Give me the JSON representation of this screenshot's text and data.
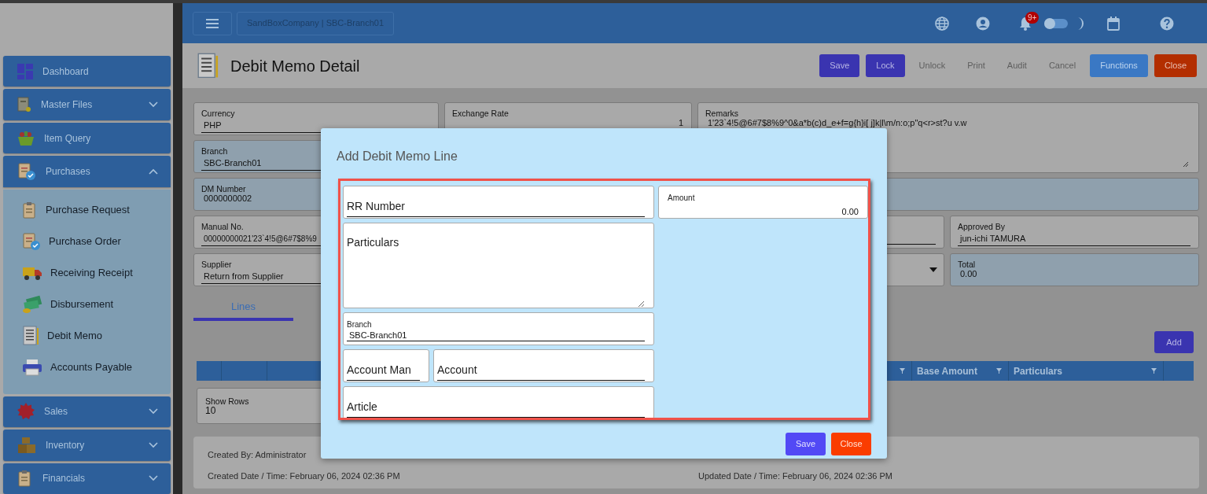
{
  "sidebar": {
    "items": [
      {
        "label": "Dashboard",
        "kind": "link"
      },
      {
        "label": "Master Files",
        "kind": "group",
        "expanded": false
      },
      {
        "label": "Item Query",
        "kind": "link"
      },
      {
        "label": "Purchases",
        "kind": "group",
        "expanded": true,
        "children": [
          {
            "label": "Purchase Request"
          },
          {
            "label": "Purchase Order"
          },
          {
            "label": "Receiving Receipt"
          },
          {
            "label": "Disbursement"
          },
          {
            "label": "Debit Memo"
          },
          {
            "label": "Accounts Payable"
          }
        ]
      },
      {
        "label": "Sales",
        "kind": "group",
        "expanded": false
      },
      {
        "label": "Inventory",
        "kind": "group",
        "expanded": false
      },
      {
        "label": "Financials",
        "kind": "group",
        "expanded": false
      }
    ]
  },
  "topbar": {
    "company": "SandBoxCompany | SBC-Branch01",
    "notification_badge": "9+",
    "dark_mode": false
  },
  "page": {
    "title": "Debit Memo Detail",
    "actions": [
      {
        "label": "Save",
        "kind": "primary",
        "disabled": false
      },
      {
        "label": "Lock",
        "kind": "primary",
        "disabled": false
      },
      {
        "label": "Unlock",
        "disabled": true
      },
      {
        "label": "Print",
        "disabled": true
      },
      {
        "label": "Audit",
        "disabled": true
      },
      {
        "label": "Cancel",
        "disabled": true
      },
      {
        "label": "Functions",
        "kind": "info",
        "disabled": false
      },
      {
        "label": "Close",
        "kind": "danger",
        "disabled": false
      }
    ]
  },
  "form": {
    "fields": [
      {
        "label": "Currency",
        "value": "PHP",
        "kind": "text",
        "disabled": false
      },
      {
        "label": "Exchange Rate",
        "value": "1",
        "kind": "number",
        "disabled": false
      },
      {
        "label": "Remarks",
        "value": "1'23`4!5@6#7$8%9^0&a*b(c)d_e+f=g{h}i[ j]k|l\\m/n:o;p\"q<r>st?u v.w",
        "kind": "textarea",
        "disabled": false
      },
      {
        "label": "Branch",
        "value": "SBC-Branch01",
        "kind": "text",
        "disabled": true
      },
      {
        "label": "DM Number",
        "value": "0000000002",
        "kind": "plain",
        "disabled": true
      },
      {
        "kind": "plain",
        "disabled": true
      },
      {
        "label": "Manual No.",
        "value": "00000000021'23`4!5@6#7$8%9",
        "kind": "text",
        "disabled": false
      },
      {
        "kind": "text",
        "disabled": false
      },
      {
        "label": "Approved By",
        "value": "jun-ichi TAMURA",
        "kind": "text",
        "disabled": false
      },
      {
        "label": "Supplier",
        "value": "Return from Supplier",
        "kind": "text",
        "disabled": false
      },
      {
        "kind": "select",
        "disabled": false
      },
      {
        "label": "Total",
        "value": "0.00",
        "kind": "plain",
        "disabled": true
      }
    ]
  },
  "tabs": [
    {
      "label": "Lines",
      "selected": true
    }
  ],
  "add_button": "Add",
  "table": {
    "columns": [
      "Base Amount",
      "Particulars"
    ]
  },
  "show_rows": {
    "label": "Show Rows",
    "value": "10"
  },
  "footer": {
    "created_by": "Created By: Administrator",
    "created_date": "Created Date / Time: February 06, 2024 02:36 PM",
    "updated_date": "Updated Date / Time: February 06, 2024 02:36 PM"
  },
  "modal": {
    "title": "Add Debit Memo Line",
    "fields": [
      {
        "placeholder": "RR Number",
        "kind": "input"
      },
      {
        "label": "Amount",
        "value": "0.00",
        "kind": "number"
      },
      {
        "placeholder": "Particulars",
        "kind": "textarea"
      },
      {
        "label": "Branch",
        "value": "SBC-Branch01",
        "kind": "text"
      },
      {
        "placeholder": "Account Man",
        "kind": "input"
      },
      {
        "placeholder": "Account",
        "kind": "input"
      },
      {
        "placeholder": "Article",
        "kind": "input"
      }
    ],
    "buttons": [
      {
        "label": "Save",
        "kind": "primary"
      },
      {
        "label": "Close",
        "kind": "danger"
      }
    ]
  }
}
